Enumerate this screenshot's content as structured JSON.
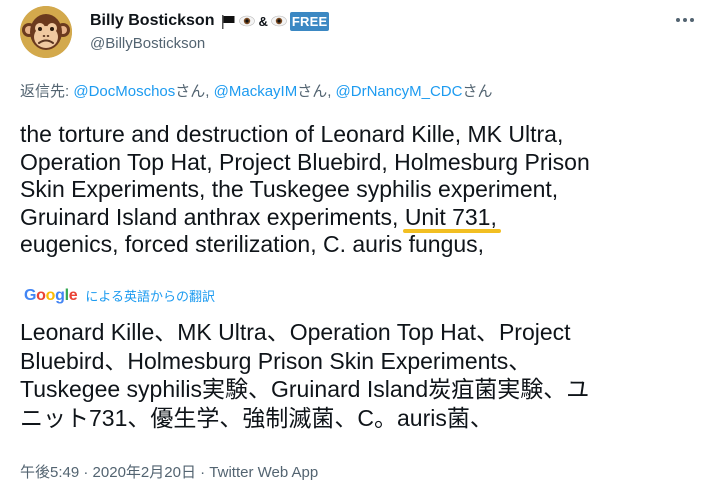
{
  "user": {
    "display_name": "Billy Bostickson",
    "handle": "@BillyBostickson",
    "name_emojis": [
      "black-flag-icon",
      "eye-icon",
      "&",
      "eye-icon",
      "free-badge-icon"
    ],
    "ampersand": "&",
    "free_badge": "FREE"
  },
  "reply": {
    "prefix": "返信先: ",
    "mentions": [
      {
        "handle": "@DocMoschos",
        "suffix": "さん, "
      },
      {
        "handle": "@MackayIM",
        "suffix": "さん, "
      },
      {
        "handle": "@DrNancyM_CDC",
        "suffix": "さん"
      }
    ]
  },
  "tweet": {
    "lines": [
      "the torture and destruction of Leonard Kille, MK Ultra,",
      "Operation Top Hat, Project Bluebird, Holmesburg Prison",
      "Skin Experiments, the Tuskegee syphilis experiment,"
    ],
    "line4_before": "Gruinard Island anthrax experiments, ",
    "line4_highlight": "Unit 731,",
    "line5": "eugenics, forced sterilization, C. auris fungus,"
  },
  "translation": {
    "google_letters": [
      "G",
      "o",
      "o",
      "g",
      "l",
      "e"
    ],
    "google_colors": [
      "#4285f4",
      "#ea4335",
      "#fbbc05",
      "#4285f4",
      "#34a853",
      "#ea4335"
    ],
    "label": "による英語からの翻訳",
    "lines": [
      "Leonard Kille、MK Ultra、Operation Top Hat、Project",
      "Bluebird、Holmesburg Prison Skin Experiments、",
      "Tuskegee syphilis実験、Gruinard Island炭疽菌実験、ユ",
      "ニット731、優生学、強制滅菌、C。auris菌、"
    ]
  },
  "meta": {
    "time": "午後5:49",
    "sep1": " · ",
    "date": "2020年2月20日",
    "sep2": " · ",
    "source": "Twitter Web App"
  },
  "colors": {
    "accent": "#1d9bf0",
    "secondary_text": "#536471",
    "highlight_underline": "#f2bf22"
  }
}
